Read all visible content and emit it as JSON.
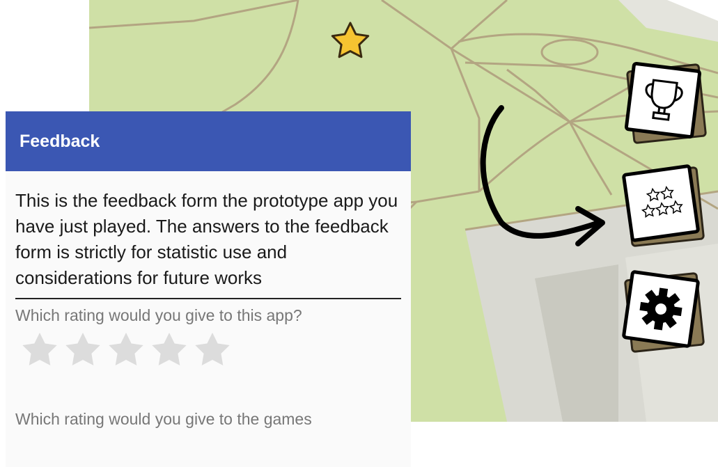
{
  "feedback": {
    "title": "Feedback",
    "intro": "This is the feedback form the prototype app you have just played. The answers to the feedback form is strictly for statistic use and considerations for future works",
    "question_app_rating": "Which rating would you give to this app?",
    "app_rating": {
      "value": 0,
      "max": 5
    },
    "question_games_rating": "Which rating would you give to the games"
  },
  "side_buttons": [
    {
      "name": "trophy-button",
      "icon": "trophy-icon"
    },
    {
      "name": "rating-button",
      "icon": "stars-icon"
    },
    {
      "name": "settings-button",
      "icon": "gear-icon"
    }
  ],
  "map": {
    "marker_icon": "star-icon"
  },
  "colors": {
    "header": "#3b57b3",
    "map_park": "#cfe0a6",
    "map_road": "#b3a582",
    "star_empty": "#dcdcdc",
    "star_marker": "#f6c431"
  }
}
